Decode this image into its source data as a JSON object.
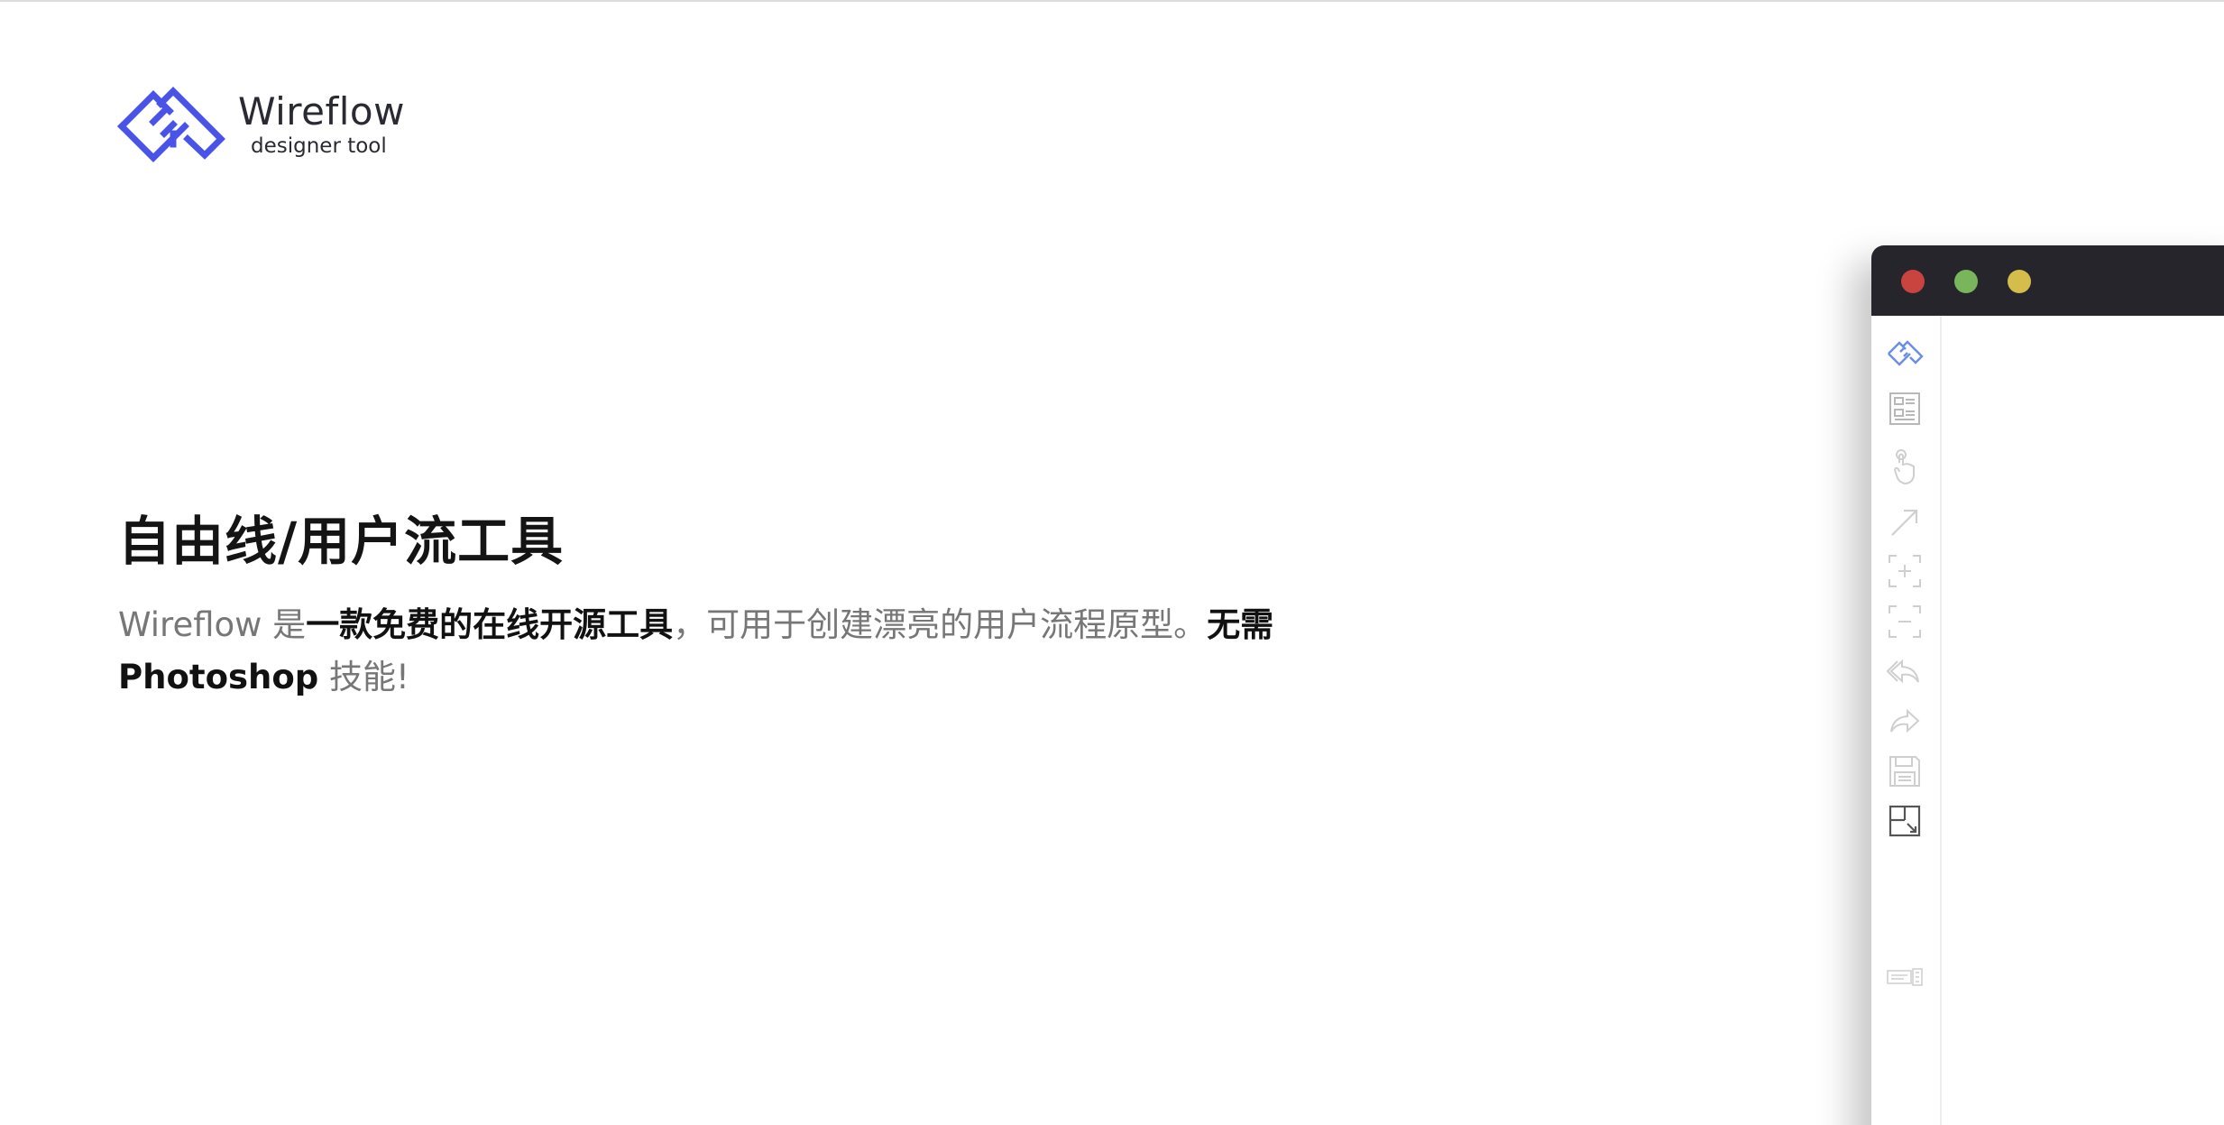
{
  "brand": {
    "name": "Wireflow",
    "tagline": "designer tool",
    "accent_color": "#4a53e8"
  },
  "hero": {
    "title": "自由线/用户流工具",
    "desc": {
      "part1": "Wireflow 是",
      "part2_bold": "一款免费的在线开源工具",
      "part3": "，可用于创建漂亮的用户流程原型。",
      "part4_bold": "无需 Photoshop",
      "part5": " 技能!"
    }
  },
  "app_window": {
    "titlebar_color": "#26252c",
    "buttons": [
      "close",
      "minimize",
      "maximize"
    ],
    "toolbar": [
      {
        "icon": "wireflow-logo-icon",
        "active": true
      },
      {
        "icon": "image-panel-icon"
      },
      {
        "icon": "hand-pointer-icon"
      },
      {
        "icon": "arrow-connector-icon"
      },
      {
        "icon": "zoom-in-icon"
      },
      {
        "icon": "zoom-out-icon"
      },
      {
        "icon": "undo-icon"
      },
      {
        "icon": "redo-icon"
      },
      {
        "icon": "save-icon"
      },
      {
        "icon": "fit-screen-icon"
      },
      {
        "icon": "export-icon"
      }
    ]
  }
}
